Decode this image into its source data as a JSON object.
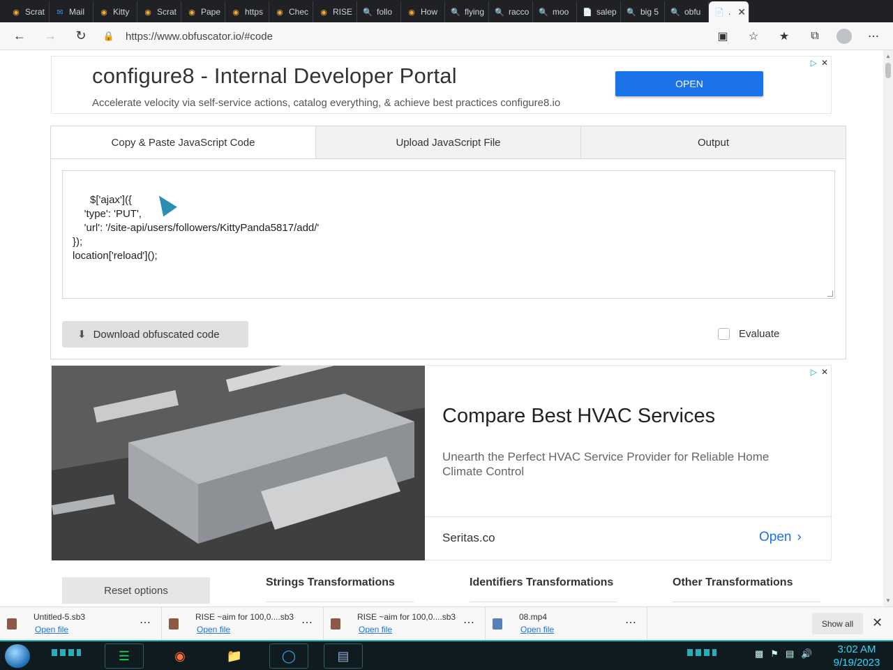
{
  "browser": {
    "tabs": [
      {
        "label": "Scrat",
        "icon": "scratch-icon"
      },
      {
        "label": "Mail",
        "icon": "outlook-icon"
      },
      {
        "label": "Kitty",
        "icon": "scratch-icon"
      },
      {
        "label": "Scrat",
        "icon": "scratch-icon"
      },
      {
        "label": "Pape",
        "icon": "scratch-icon"
      },
      {
        "label": "https",
        "icon": "scratch-icon"
      },
      {
        "label": "Chec",
        "icon": "scratch-icon"
      },
      {
        "label": "RISE",
        "icon": "scratch-icon"
      },
      {
        "label": "follo",
        "icon": "search-icon"
      },
      {
        "label": "How",
        "icon": "scratch-icon"
      },
      {
        "label": "flying",
        "icon": "search-icon"
      },
      {
        "label": "racco",
        "icon": "search-icon"
      },
      {
        "label": "moo",
        "icon": "search-icon"
      },
      {
        "label": "salep",
        "icon": "page-icon"
      },
      {
        "label": "big 5",
        "icon": "search-icon"
      },
      {
        "label": "obfu",
        "icon": "search-icon"
      }
    ],
    "active_tab": {
      "label": ".",
      "icon": "page-icon"
    },
    "url": "https://www.obfuscator.io/#code"
  },
  "ad_top": {
    "title": "configure8 - Internal Developer Portal",
    "subtitle": "Accelerate velocity via self-service actions, catalog everything, & achieve best practices configure8.io",
    "button": "OPEN"
  },
  "panel": {
    "tabs": [
      "Copy & Paste JavaScript Code",
      "Upload JavaScript File",
      "Output"
    ],
    "code": "$['ajax']({\n    'type': 'PUT',\n    'url': '/site-api/users/followers/KittyPanda5817/add/'\n});\nlocation['reload']();",
    "download_label": "Download obfuscated code",
    "evaluate_label": "Evaluate"
  },
  "ad_bottom": {
    "title": "Compare Best HVAC Services",
    "description": "Unearth the Perfect HVAC Service Provider for Reliable Home Climate Control",
    "site": "Seritas.co",
    "open": "Open"
  },
  "options": {
    "reset": "Reset options",
    "tabs": [
      "Strings Transformations",
      "Identifiers Transformations",
      "Other Transformations"
    ]
  },
  "downloads": {
    "items": [
      {
        "name": "Untitled-5.sb3",
        "action": "Open file",
        "type": "sb3"
      },
      {
        "name": "RISE ~aim for 100,0....sb3",
        "action": "Open file",
        "type": "sb3"
      },
      {
        "name": "RISE ~aim for 100,0....sb3",
        "action": "Open file",
        "type": "sb3"
      },
      {
        "name": "08.mp4",
        "action": "Open file",
        "type": "mp4"
      }
    ],
    "show_all": "Show all"
  },
  "taskbar": {
    "time": "3:02 AM",
    "date": "9/19/2023"
  },
  "colors": {
    "accent_blue": "#1a73e8",
    "taskbar_cyan": "#2ed8ff"
  }
}
